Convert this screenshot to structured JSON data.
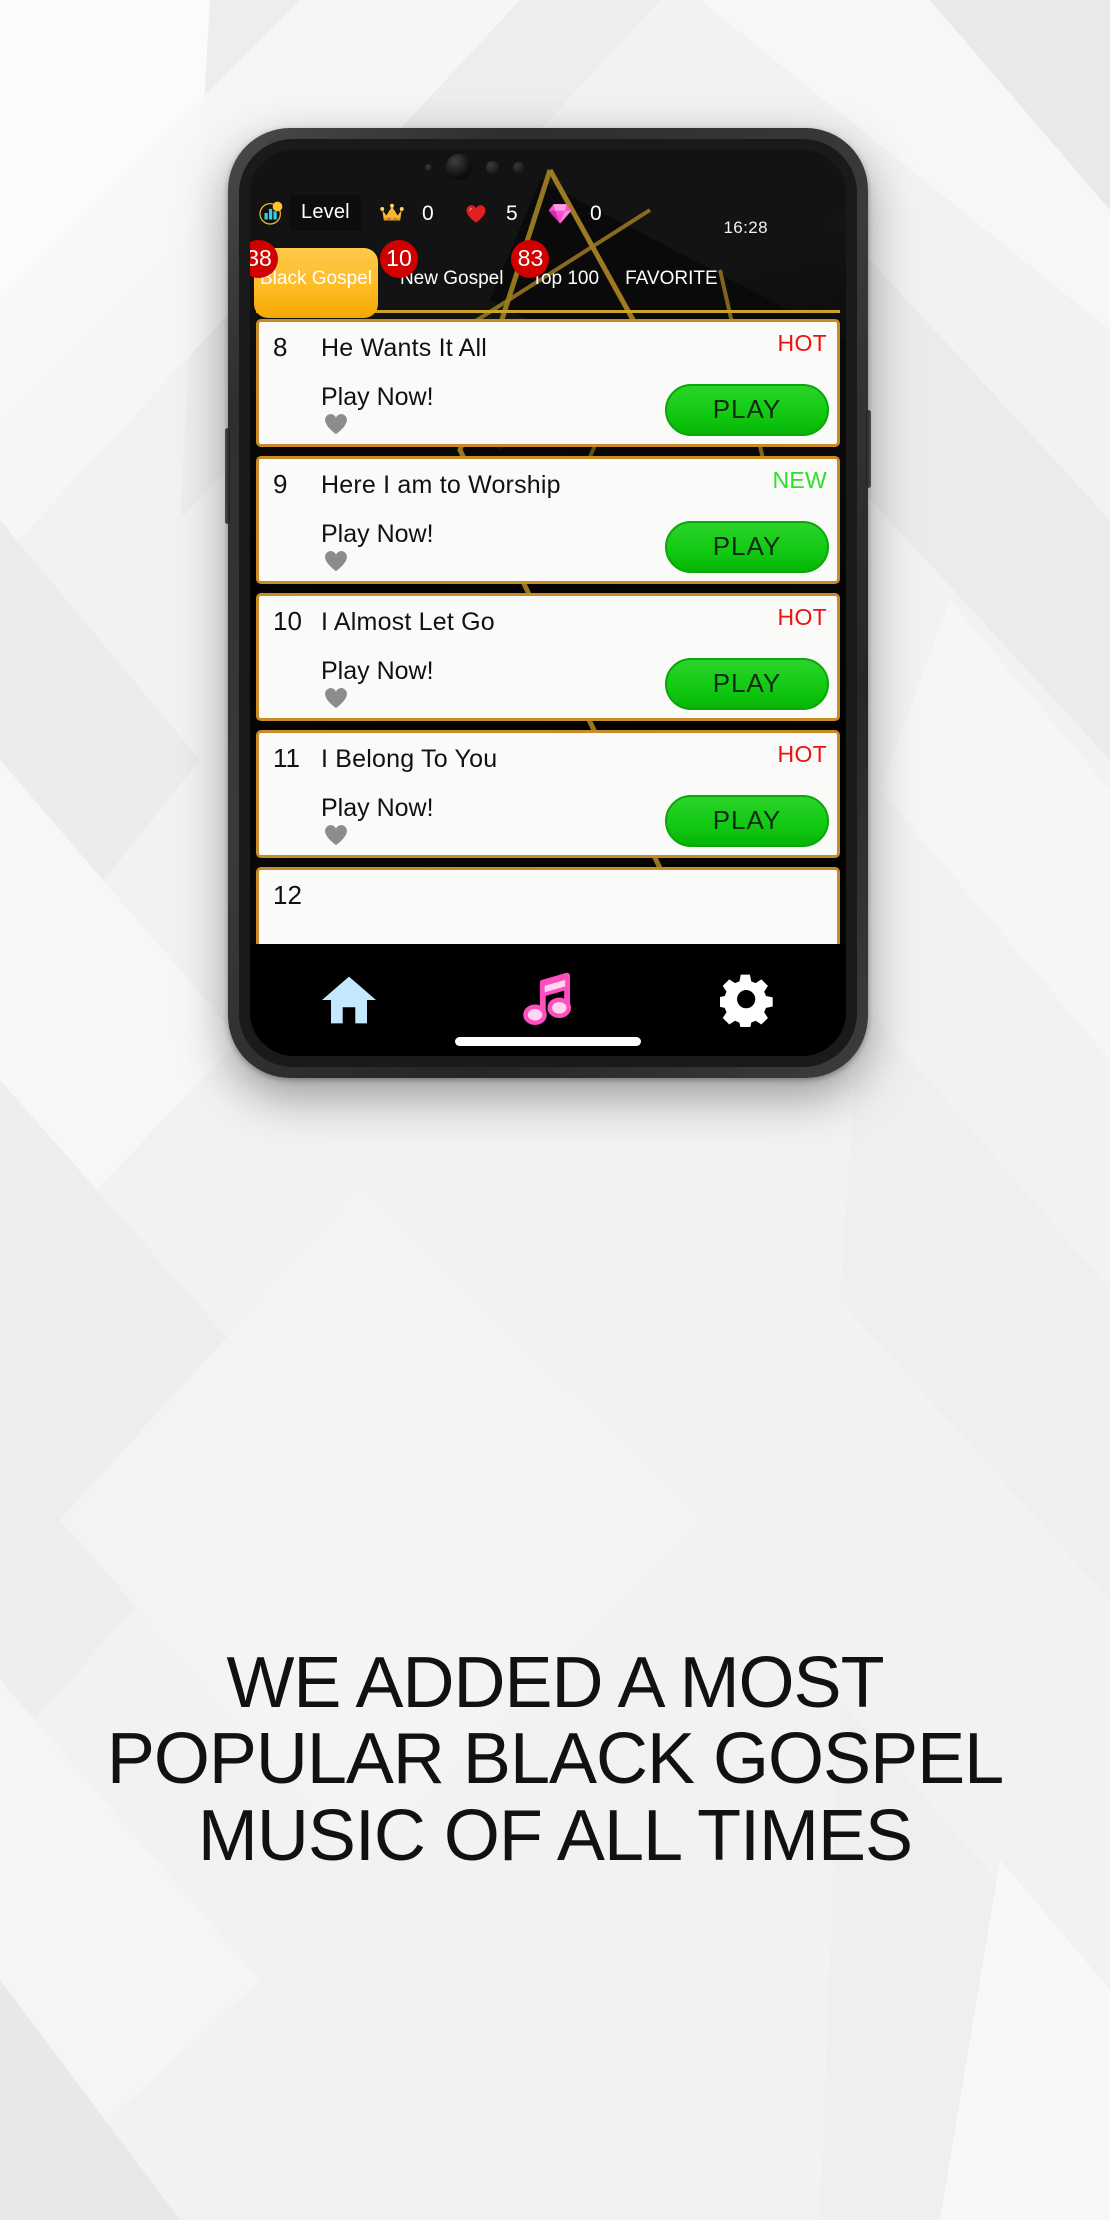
{
  "status_bar": {
    "level_icon": "chart-level-icon",
    "level_label": "Level",
    "crown_icon": "crown-icon",
    "crown_value": "0",
    "heart_icon": "heart-icon",
    "heart_value": "5",
    "gem_icon": "diamond-icon",
    "gem_value": "0",
    "clock": "16:28"
  },
  "tabs": [
    {
      "label": "Black Gospel",
      "badge": "38",
      "active": true
    },
    {
      "label": "New Gospel",
      "badge": "10",
      "active": false
    },
    {
      "label": "Top 100",
      "badge": "83",
      "active": false
    },
    {
      "label": "FAVORITE",
      "badge": "",
      "active": false
    }
  ],
  "songs": [
    {
      "rank": "8",
      "title": "He Wants It All",
      "subtitle": "Play Now!",
      "tag": "HOT",
      "tag_type": "hot",
      "play_label": "PLAY"
    },
    {
      "rank": "9",
      "title": "Here I am to Worship",
      "subtitle": "Play Now!",
      "tag": "NEW",
      "tag_type": "new",
      "play_label": "PLAY"
    },
    {
      "rank": "10",
      "title": "I Almost Let Go",
      "subtitle": "Play Now!",
      "tag": "HOT",
      "tag_type": "hot",
      "play_label": "PLAY"
    },
    {
      "rank": "11",
      "title": "I Belong To You",
      "subtitle": "Play Now!",
      "tag": "HOT",
      "tag_type": "hot",
      "play_label": "PLAY"
    },
    {
      "rank": "12",
      "title": "",
      "subtitle": "",
      "tag": "",
      "tag_type": "",
      "play_label": ""
    }
  ],
  "bottom_nav": [
    {
      "icon": "home-icon",
      "color": "#bfe6ff"
    },
    {
      "icon": "music-note-icon",
      "color": "#ff4fbf"
    },
    {
      "icon": "gear-icon",
      "color": "#ffffff"
    }
  ],
  "headline": "WE ADDED A MOST POPULAR BLACK GOSPEL MUSIC OF ALL TIMES",
  "colors": {
    "accent_gold": "#ffbc24",
    "badge_red": "#d00000",
    "play_green": "#12c912",
    "tag_hot": "#f01010",
    "tag_new": "#2ee02e",
    "card_border": "#c98a28",
    "page_bg": "#f3f3f3"
  }
}
